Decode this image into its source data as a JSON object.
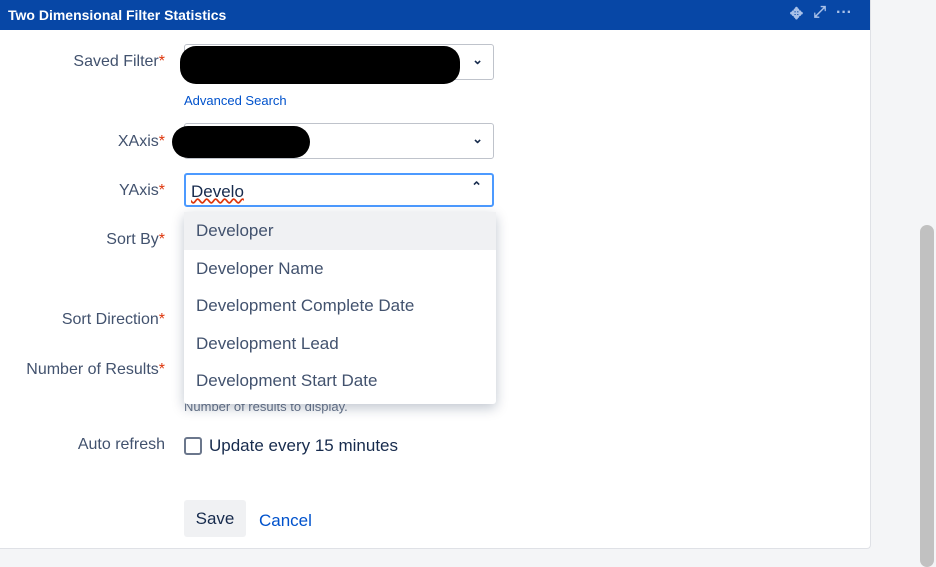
{
  "header": {
    "title": "Two Dimensional Filter Statistics",
    "icons": [
      "move-icon",
      "expand-icon",
      "more-icon"
    ]
  },
  "form": {
    "saved_filter": {
      "label": "Saved Filter",
      "required": "*"
    },
    "advanced_search": "Advanced Search",
    "xaxis": {
      "label": "XAxis",
      "required": "*"
    },
    "yaxis": {
      "label": "YAxis",
      "required": "*",
      "value": "Develo"
    },
    "sort_by": {
      "label": "Sort By",
      "required": "*"
    },
    "sort_direction": {
      "label": "Sort Direction",
      "required": "*"
    },
    "number_of_results": {
      "label": "Number of Results",
      "required": "*",
      "help": "Number of results to display."
    },
    "auto_refresh": {
      "label": "Auto refresh",
      "checkbox_label": "Update every 15 minutes",
      "checked": false
    },
    "save": "Save",
    "cancel": "Cancel"
  },
  "dropdown": {
    "options": [
      "Developer",
      "Developer Name",
      "Development Complete Date",
      "Development Lead",
      "Development Start Date"
    ],
    "highlighted": 0
  },
  "colors": {
    "header": "#0747a6",
    "link": "#0052cc",
    "required": "#de350b"
  }
}
